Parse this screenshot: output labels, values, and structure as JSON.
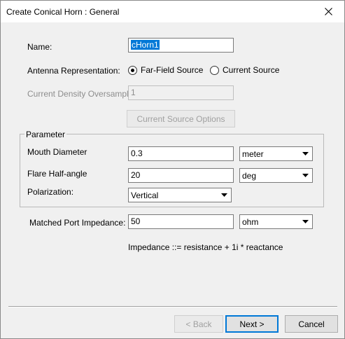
{
  "window": {
    "title": "Create Conical Horn : General"
  },
  "form": {
    "name_label": "Name:",
    "name_value": "cHorn1",
    "representation_label": "Antenna Representation:",
    "representation_options": [
      "Far-Field Source",
      "Current Source"
    ],
    "representation_selected": "Far-Field Source",
    "oversample_label": "Current Density Oversample",
    "oversample_value": "1",
    "current_source_options_label": "Current Source Options"
  },
  "parameter": {
    "group_title": "Parameter",
    "mouth_diameter_label": "Mouth Diameter",
    "mouth_diameter_value": "0.3",
    "mouth_diameter_unit": "meter",
    "flare_label": "Flare Half-angle",
    "flare_value": "20",
    "flare_unit": "deg",
    "polarization_label": "Polarization:",
    "polarization_value": "Vertical"
  },
  "impedance": {
    "label": "Matched Port Impedance:",
    "value": "50",
    "unit": "ohm",
    "hint": "Impedance ::= resistance + 1i * reactance"
  },
  "footer": {
    "back_label": "< Back",
    "next_label": "Next >",
    "cancel_label": "Cancel"
  },
  "colors": {
    "selection": "#0078d7",
    "disabled_text": "#8d8d8d"
  }
}
